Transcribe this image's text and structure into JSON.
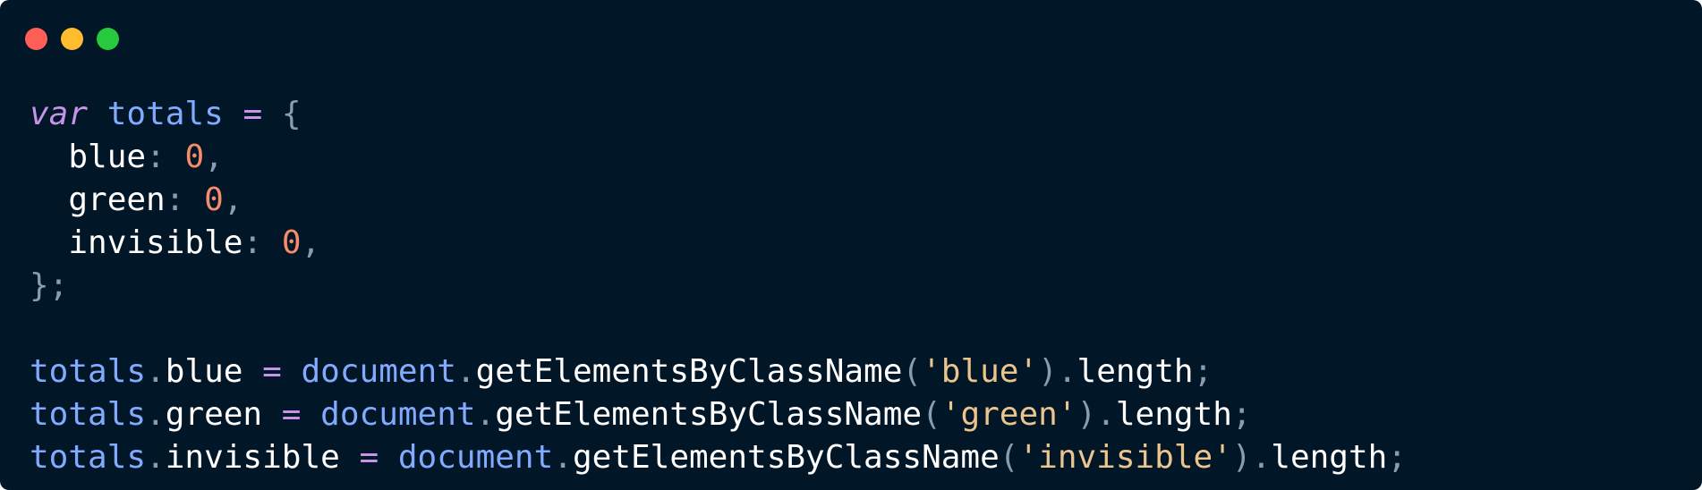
{
  "window": {
    "controls": {
      "close_color": "#ff5f56",
      "minimize_color": "#ffbd2e",
      "zoom_color": "#27c93f"
    },
    "background": "#011627"
  },
  "code": {
    "language": "javascript",
    "lines": [
      [
        {
          "t": "var",
          "k": "keyword"
        },
        {
          "t": " ",
          "k": "ws"
        },
        {
          "t": "totals",
          "k": "var"
        },
        {
          "t": " ",
          "k": "ws"
        },
        {
          "t": "=",
          "k": "op"
        },
        {
          "t": " ",
          "k": "ws"
        },
        {
          "t": "{",
          "k": "punc"
        }
      ],
      [
        {
          "t": "  ",
          "k": "ws"
        },
        {
          "t": "blue",
          "k": "prop"
        },
        {
          "t": ":",
          "k": "punc"
        },
        {
          "t": " ",
          "k": "ws"
        },
        {
          "t": "0",
          "k": "num"
        },
        {
          "t": ",",
          "k": "punc"
        }
      ],
      [
        {
          "t": "  ",
          "k": "ws"
        },
        {
          "t": "green",
          "k": "prop"
        },
        {
          "t": ":",
          "k": "punc"
        },
        {
          "t": " ",
          "k": "ws"
        },
        {
          "t": "0",
          "k": "num"
        },
        {
          "t": ",",
          "k": "punc"
        }
      ],
      [
        {
          "t": "  ",
          "k": "ws"
        },
        {
          "t": "invisible",
          "k": "prop"
        },
        {
          "t": ":",
          "k": "punc"
        },
        {
          "t": " ",
          "k": "ws"
        },
        {
          "t": "0",
          "k": "num"
        },
        {
          "t": ",",
          "k": "punc"
        }
      ],
      [
        {
          "t": "};",
          "k": "punc"
        }
      ],
      [],
      [
        {
          "t": "totals",
          "k": "var"
        },
        {
          "t": ".",
          "k": "punc"
        },
        {
          "t": "blue",
          "k": "prop"
        },
        {
          "t": " ",
          "k": "ws"
        },
        {
          "t": "=",
          "k": "op"
        },
        {
          "t": " ",
          "k": "ws"
        },
        {
          "t": "document",
          "k": "var"
        },
        {
          "t": ".",
          "k": "punc"
        },
        {
          "t": "getElementsByClassName",
          "k": "method"
        },
        {
          "t": "(",
          "k": "punc"
        },
        {
          "t": "'blue'",
          "k": "str"
        },
        {
          "t": ")",
          "k": "punc"
        },
        {
          "t": ".",
          "k": "punc"
        },
        {
          "t": "length",
          "k": "prop"
        },
        {
          "t": ";",
          "k": "punc"
        }
      ],
      [
        {
          "t": "totals",
          "k": "var"
        },
        {
          "t": ".",
          "k": "punc"
        },
        {
          "t": "green",
          "k": "prop"
        },
        {
          "t": " ",
          "k": "ws"
        },
        {
          "t": "=",
          "k": "op"
        },
        {
          "t": " ",
          "k": "ws"
        },
        {
          "t": "document",
          "k": "var"
        },
        {
          "t": ".",
          "k": "punc"
        },
        {
          "t": "getElementsByClassName",
          "k": "method"
        },
        {
          "t": "(",
          "k": "punc"
        },
        {
          "t": "'green'",
          "k": "str"
        },
        {
          "t": ")",
          "k": "punc"
        },
        {
          "t": ".",
          "k": "punc"
        },
        {
          "t": "length",
          "k": "prop"
        },
        {
          "t": ";",
          "k": "punc"
        }
      ],
      [
        {
          "t": "totals",
          "k": "var"
        },
        {
          "t": ".",
          "k": "punc"
        },
        {
          "t": "invisible",
          "k": "prop"
        },
        {
          "t": " ",
          "k": "ws"
        },
        {
          "t": "=",
          "k": "op"
        },
        {
          "t": " ",
          "k": "ws"
        },
        {
          "t": "document",
          "k": "var"
        },
        {
          "t": ".",
          "k": "punc"
        },
        {
          "t": "getElementsByClassName",
          "k": "method"
        },
        {
          "t": "(",
          "k": "punc"
        },
        {
          "t": "'invisible'",
          "k": "str"
        },
        {
          "t": ")",
          "k": "punc"
        },
        {
          "t": ".",
          "k": "punc"
        },
        {
          "t": "length",
          "k": "prop"
        },
        {
          "t": ";",
          "k": "punc"
        }
      ]
    ],
    "colors": {
      "keyword": "#c792ea",
      "var": "#82aaff",
      "op": "#c792ea",
      "punc": "#8a9bb4",
      "prop": "#ffffff",
      "num": "#f78c6c",
      "str": "#ecc48d",
      "method": "#ffffff"
    }
  }
}
